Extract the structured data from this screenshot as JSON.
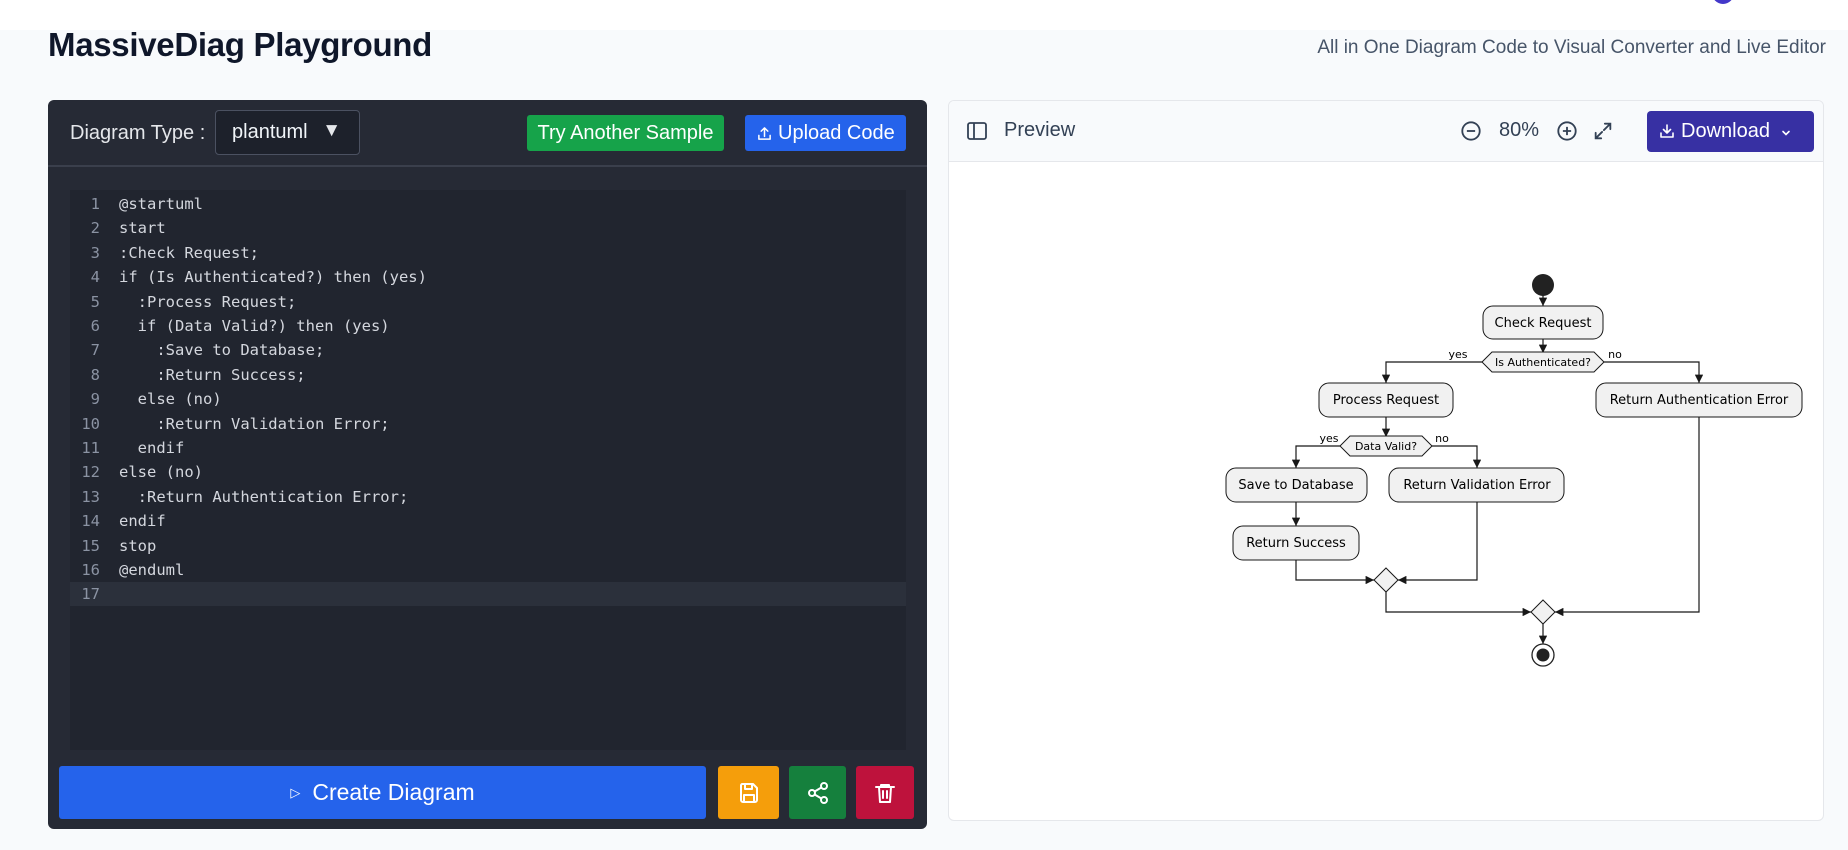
{
  "page": {
    "title": "MassiveDiag Playground",
    "subtitle": "All in One Diagram Code to Visual Converter and Live Editor"
  },
  "editor": {
    "diagram_type_label": "Diagram Type :",
    "diagram_type_value": "plantuml",
    "caret": "▼",
    "try_sample_label": "Try Another Sample",
    "upload_label": "Upload Code",
    "lines": [
      {
        "n": "1",
        "text": "@startuml"
      },
      {
        "n": "2",
        "text": "start"
      },
      {
        "n": "3",
        "text": ":Check Request;"
      },
      {
        "n": "4",
        "text": "if (Is Authenticated?) then (yes)"
      },
      {
        "n": "5",
        "text": "  :Process Request;"
      },
      {
        "n": "6",
        "text": "  if (Data Valid?) then (yes)"
      },
      {
        "n": "7",
        "text": "    :Save to Database;"
      },
      {
        "n": "8",
        "text": "    :Return Success;"
      },
      {
        "n": "9",
        "text": "  else (no)"
      },
      {
        "n": "10",
        "text": "    :Return Validation Error;"
      },
      {
        "n": "11",
        "text": "  endif"
      },
      {
        "n": "12",
        "text": "else (no)"
      },
      {
        "n": "13",
        "text": "  :Return Authentication Error;"
      },
      {
        "n": "14",
        "text": "endif"
      },
      {
        "n": "15",
        "text": "stop"
      },
      {
        "n": "16",
        "text": "@enduml"
      },
      {
        "n": "17",
        "text": ""
      }
    ],
    "create_label": "Create Diagram",
    "create_icon": "▷"
  },
  "preview": {
    "label": "Preview",
    "zoom": "80%",
    "download_label": "Download"
  },
  "diagram": {
    "check_request": "Check Request",
    "is_authenticated": "Is Authenticated?",
    "yes1": "yes",
    "no1": "no",
    "process_request": "Process Request",
    "return_auth_error": "Return Authentication Error",
    "data_valid": "Data Valid?",
    "yes2": "yes",
    "no2": "no",
    "save_to_database": "Save to Database",
    "return_validation_error": "Return Validation Error",
    "return_success": "Return Success"
  },
  "colors": {
    "editor_bg": "#262a35",
    "sample_green": "#16a34a",
    "primary_blue": "#2563eb",
    "save_amber": "#f59e0b",
    "share_green": "#15803d",
    "delete_red": "#be123c",
    "download_indigo": "#3730a3"
  }
}
